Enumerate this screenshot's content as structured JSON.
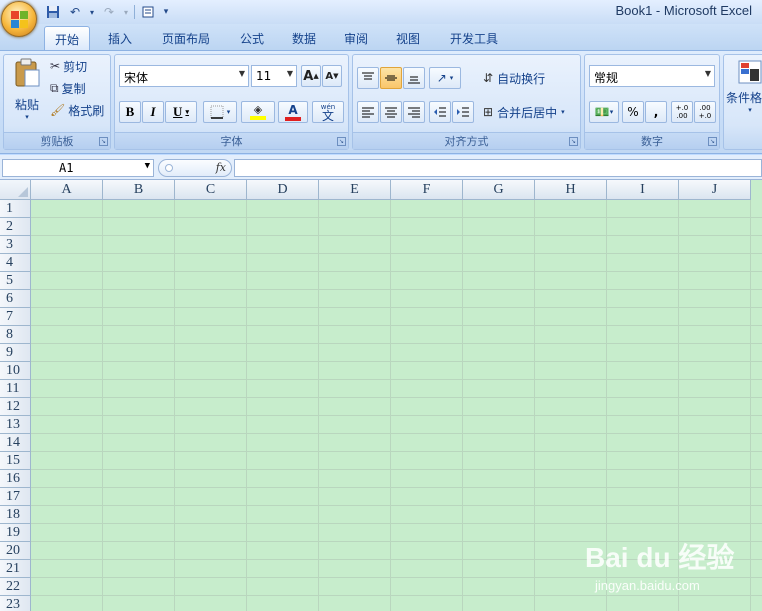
{
  "window": {
    "title": "Book1 - Microsoft Excel"
  },
  "qat": {
    "save_icon": "save-icon",
    "undo_icon": "undo-icon",
    "redo_icon": "redo-icon",
    "page_setup_icon": "print-preview-icon",
    "customize_icon": "chevron-down-icon"
  },
  "tabs": [
    {
      "label": "开始"
    },
    {
      "label": "插入"
    },
    {
      "label": "页面布局"
    },
    {
      "label": "公式"
    },
    {
      "label": "数据"
    },
    {
      "label": "审阅"
    },
    {
      "label": "视图"
    },
    {
      "label": "开发工具"
    }
  ],
  "clipboard": {
    "title": "剪贴板",
    "paste": "粘贴",
    "cut": "剪切",
    "copy": "复制",
    "format_painter": "格式刷"
  },
  "font": {
    "title": "字体",
    "name": "宋体",
    "size": "11",
    "bold": "B",
    "italic": "I",
    "underline": "U",
    "grow": "A",
    "shrink": "A",
    "wen": "wén",
    "wen_char": "文",
    "font_color_letter": "A"
  },
  "alignment": {
    "title": "对齐方式",
    "wrap": "自动换行",
    "merge": "合并后居中"
  },
  "number": {
    "title": "数字",
    "format": "常规",
    "percent": "%",
    "comma": ",",
    "inc": "+.0\n.00",
    "dec": ".00\n+.0"
  },
  "styles": {
    "conditional": "条件格式"
  },
  "formula_bar": {
    "cell": "A1",
    "fx": "fx",
    "value": ""
  },
  "columns": [
    "A",
    "B",
    "C",
    "D",
    "E",
    "F",
    "G",
    "H",
    "I",
    "J"
  ],
  "rows": [
    "1",
    "2",
    "3",
    "4",
    "5",
    "6",
    "7",
    "8",
    "9",
    "10",
    "11",
    "12",
    "13",
    "14",
    "15",
    "16",
    "17",
    "18",
    "19",
    "20",
    "21",
    "22",
    "23"
  ],
  "watermark": {
    "brand": "Bai du 经验",
    "url": "jingyan.baidu.com"
  },
  "colors": {
    "sheet_bg": "#c7edcc",
    "ribbon": "#dbe8fa",
    "accent_orange": "#f9c66a",
    "font_red": "#e02020",
    "highlight_yellow": "#ffff00"
  }
}
